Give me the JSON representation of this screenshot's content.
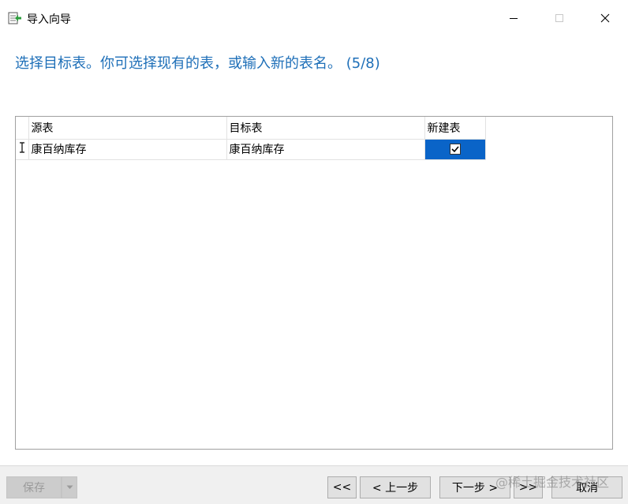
{
  "window": {
    "title": "导入向导",
    "minimize_icon": "minimize-icon",
    "maximize_icon": "maximize-icon",
    "close_icon": "close-icon"
  },
  "heading": "选择目标表。你可选择现有的表，或输入新的表名。 (5/8)",
  "grid": {
    "columns": [
      "源表",
      "目标表",
      "新建表"
    ],
    "rows": [
      {
        "source": "康百纳库存",
        "target": "康百纳库存",
        "new_table": true
      }
    ]
  },
  "footer": {
    "save_label": "保存",
    "first_label": "<<",
    "prev_label": "< 上一步",
    "next_label": "下一步 >",
    "last_label": ">>",
    "cancel_label": "取消"
  },
  "watermark": "@稀土掘金技术社区",
  "colors": {
    "heading": "#1e6fb8",
    "selection": "#0a64c8"
  }
}
